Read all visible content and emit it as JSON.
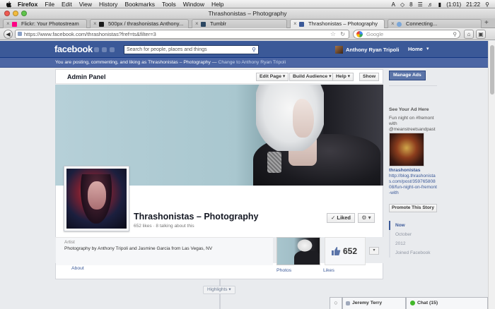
{
  "menubar": {
    "items": [
      "Firefox",
      "File",
      "Edit",
      "View",
      "History",
      "Bookmarks",
      "Tools",
      "Window",
      "Help"
    ],
    "status": [
      "A",
      "8",
      "(1:01)",
      "21:22"
    ],
    "icons": [
      "apple-icon",
      "dropbox-icon",
      "wifi-icon",
      "volume-icon",
      "battery-icon",
      "spotlight-icon"
    ]
  },
  "window": {
    "title": "Thrashonistas – Photography"
  },
  "tabs": [
    {
      "label": "Flickr: Your Photostream",
      "color": "#ff0084"
    },
    {
      "label": "500px / thrashonistas Anthony...",
      "color": "#1a1a1a"
    },
    {
      "label": "Tumblr",
      "color": "#2c4762"
    },
    {
      "label": "Thrashonistas – Photography",
      "color": "#3b5998",
      "active": true
    },
    {
      "label": "Connecting...",
      "color": "#7aa6d8"
    }
  ],
  "toolbar": {
    "url": "https://www.facebook.com/thrashonistas?fref=ts&filter=3",
    "search_placeholder": "Google"
  },
  "facebook": {
    "logo": "facebook",
    "search_placeholder": "Search for people, places and things",
    "user_name": "Anthony Ryan Tripoli",
    "home_label": "Home",
    "notice_text": "You are posting, commenting, and liking as Thrashonistas – Photography —",
    "notice_link": "Change to Anthony Ryan Tripoli",
    "brand_color": "#3b5998"
  },
  "admin": {
    "title": "Admin Panel",
    "edit_page": "Edit Page ▾",
    "build_audience": "Build Audience ▾",
    "help": "Help ▾",
    "show": "Show"
  },
  "page": {
    "name": "Thrashonistas – Photography",
    "likes_line": "652 likes · 8 talking about this",
    "liked_label": "✓ Liked",
    "gear_label": "⚙ ▾",
    "category": "Artist",
    "description": "Photography by Anthony Tripoli and Jasmine Garcia from Las Vegas, NV",
    "about_link": "About",
    "photos_label": "Photos",
    "likes_label": "Likes",
    "likes_count": "652",
    "more_label": "▾",
    "highlights_label": "Highlights ▾"
  },
  "sidebar": {
    "manage_ads": "Manage Ads",
    "ad_heading": "See Your Ad Here",
    "ad_text": "Fun night on #fremont with @meanstreetsandpast",
    "ad_name": "thrashonistas",
    "ad_url": "http://blog.thrashonistas.com/post/35976580808/fun-night-on-fremont-with",
    "promote": "Promote This Story",
    "scrubber": [
      {
        "label": "Now",
        "active": true
      },
      {
        "label": "October"
      },
      {
        "label": "2012"
      },
      {
        "label": "Joined Facebook"
      }
    ]
  },
  "chat": {
    "contact": "Jeremy Terry",
    "chat_label": "Chat (15)"
  }
}
